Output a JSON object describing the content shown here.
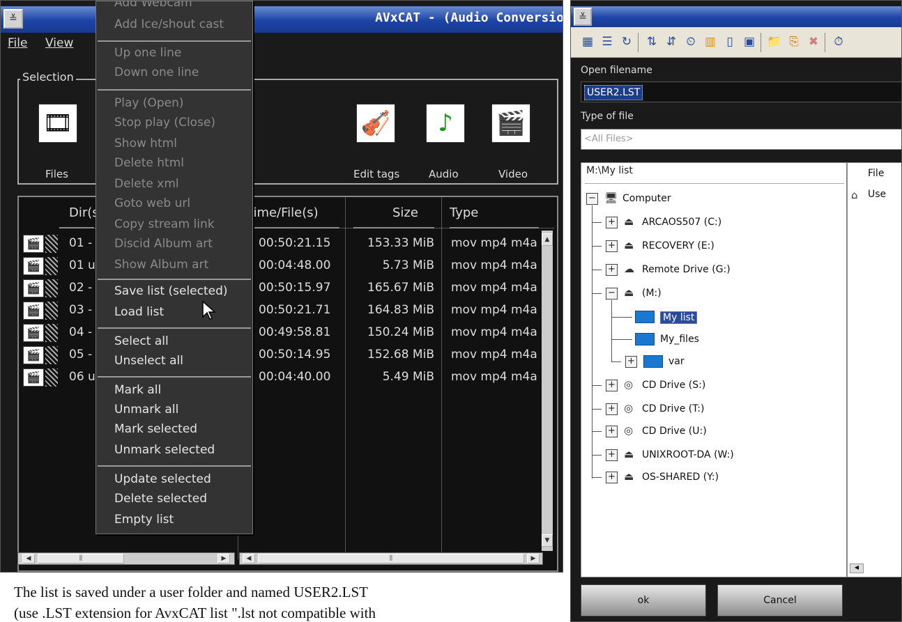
{
  "left_window": {
    "title": "AVxCAT - (Audio Conversio",
    "menubar": {
      "file": "File",
      "view": "View"
    },
    "selection_label": "Selection",
    "tools": {
      "files": "Files",
      "edit_tags": "Edit tags",
      "audio": "Audio",
      "video": "Video"
    },
    "columns": {
      "dir": "Dir(s",
      "time": "Time/File(s)",
      "size": "Size",
      "type": "Type"
    },
    "rows": [
      {
        "name": "01 -",
        "time": "00:50:21.15",
        "size": "153.33 MiB",
        "type": "mov mp4 m4a"
      },
      {
        "name": "01 u",
        "time": "00:04:48.00",
        "size": "5.73 MiB",
        "type": "mov mp4 m4a"
      },
      {
        "name": "02 -",
        "time": "00:50:15.97",
        "size": "165.67 MiB",
        "type": "mov mp4 m4a"
      },
      {
        "name": "03 -",
        "time": "00:50:21.71",
        "size": "164.83 MiB",
        "type": "mov mp4 m4a"
      },
      {
        "name": "04 -",
        "time": "00:49:58.81",
        "size": "150.24 MiB",
        "type": "mov mp4 m4a"
      },
      {
        "name": "05 -",
        "time": "00:50:14.95",
        "size": "152.68 MiB",
        "type": "mov mp4 m4a"
      },
      {
        "name": "06 u",
        "time": "00:04:40.00",
        "size": "5.49 MiB",
        "type": "mov mp4 m4a"
      }
    ]
  },
  "context_menu": {
    "items": [
      "Add Webcam",
      "Add Ice/shout cast",
      "Up one line",
      "Down one line",
      "Play (Open)",
      "Stop play (Close)",
      "Show html",
      "Delete html",
      "Delete xml",
      "Goto web url",
      "Copy stream link",
      "Discid Album art",
      "Show Album art",
      "Save list (selected)",
      "Load list",
      "Select all",
      "Unselect all",
      "Mark all",
      "Unmark all",
      "Mark selected",
      "Unmark selected",
      "Update selected",
      "Delete selected",
      "Empty list"
    ]
  },
  "dialog": {
    "open_filename_label": "Open filename",
    "filename_value": "USER2.LST",
    "type_of_file_label": "Type of file",
    "type_value": "<All Files>",
    "path": "M:\\My list",
    "tree": [
      "Computer",
      "ARCAOS507 (C:)",
      "RECOVERY (E:)",
      "Remote Drive (G:)",
      "(M:)",
      "My list",
      "My_files",
      "var",
      "CD Drive (S:)",
      "CD Drive (T:)",
      "CD Drive (U:)",
      "UNIXROOT-DA (W:)",
      "OS-SHARED (Y:)"
    ],
    "file_col_head": "File",
    "file_item": "Use",
    "ok_label": "ok",
    "cancel_label": "Cancel"
  },
  "caption": {
    "line1": "The list is saved under a user folder and named USER2.LST",
    "line2": "(use .LST extension for AvxCAT list \".lst not compatible with"
  }
}
